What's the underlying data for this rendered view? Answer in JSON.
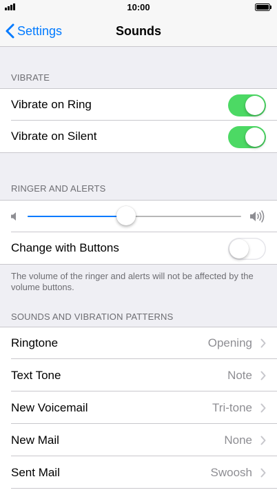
{
  "status_bar": {
    "time": "10:00"
  },
  "nav": {
    "back_label": "Settings",
    "title": "Sounds"
  },
  "vibrate": {
    "header": "VIBRATE",
    "rows": [
      {
        "label": "Vibrate on Ring",
        "on": true
      },
      {
        "label": "Vibrate on Silent",
        "on": true
      }
    ]
  },
  "ringer": {
    "header": "RINGER AND ALERTS",
    "volume_fraction": 0.46,
    "change_with_buttons": {
      "label": "Change with Buttons",
      "on": false
    },
    "footer": "The volume of the ringer and alerts will not be affected by the volume buttons."
  },
  "patterns": {
    "header": "SOUNDS AND VIBRATION PATTERNS",
    "rows": [
      {
        "label": "Ringtone",
        "value": "Opening"
      },
      {
        "label": "Text Tone",
        "value": "Note"
      },
      {
        "label": "New Voicemail",
        "value": "Tri-tone"
      },
      {
        "label": "New Mail",
        "value": "None"
      },
      {
        "label": "Sent Mail",
        "value": "Swoosh"
      }
    ]
  },
  "colors": {
    "accent": "#007aff",
    "toggle_on": "#4cd964",
    "secondary_text": "#8e8e93",
    "section_text": "#6d6d72",
    "background": "#efeff4"
  },
  "icons": {
    "back": "chevron-left-icon",
    "disclosure": "chevron-right-icon",
    "volume_low": "speaker-low-icon",
    "volume_high": "speaker-high-icon",
    "signal": "signal-bars-icon",
    "battery": "battery-icon"
  }
}
